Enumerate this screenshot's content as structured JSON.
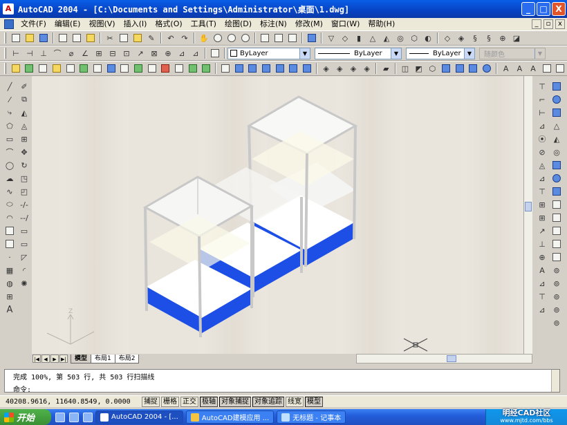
{
  "window": {
    "title": "AutoCAD 2004 - [C:\\Documents and Settings\\Administrator\\桌面\\1.dwg]",
    "app_icon": "A",
    "min_label": "_",
    "max_label": "□",
    "close_label": "X"
  },
  "menu": {
    "items": [
      {
        "label": "文件(F)"
      },
      {
        "label": "编辑(E)"
      },
      {
        "label": "视图(V)"
      },
      {
        "label": "插入(I)"
      },
      {
        "label": "格式(O)"
      },
      {
        "label": "工具(T)"
      },
      {
        "label": "绘图(D)"
      },
      {
        "label": "标注(N)"
      },
      {
        "label": "修改(M)"
      },
      {
        "label": "窗口(W)"
      },
      {
        "label": "帮助(H)"
      }
    ],
    "doc_min": "_",
    "doc_restore": "▫",
    "doc_close": "x"
  },
  "properties": {
    "layer_color": "ByLayer",
    "linetype": "ByLayer",
    "lineweight": "ByLayer",
    "plotstyle": "随颜色"
  },
  "layout_tabs": {
    "nav": [
      "|◀",
      "◀",
      "▶",
      "▶|"
    ],
    "tabs": [
      {
        "label": "模型",
        "active": true
      },
      {
        "label": "布局1",
        "active": false
      },
      {
        "label": "布局2",
        "active": false
      }
    ]
  },
  "ucs": {
    "z_label": "Z"
  },
  "command": {
    "line1": "完成 100%, 第 503 行, 共 503 行扫描线",
    "line2": "命令:"
  },
  "status": {
    "coords": "40208.9616, 11640.8549, 0.0000",
    "buttons": [
      {
        "label": "捕捉",
        "on": false
      },
      {
        "label": "栅格",
        "on": false
      },
      {
        "label": "正交",
        "on": false
      },
      {
        "label": "极轴",
        "on": true
      },
      {
        "label": "对象捕捉",
        "on": true
      },
      {
        "label": "对象追踪",
        "on": true
      },
      {
        "label": "线宽",
        "on": false
      },
      {
        "label": "模型",
        "on": true
      }
    ]
  },
  "taskbar": {
    "start_label": "开始",
    "tasks": [
      {
        "label": "AutoCAD 2004 - [...",
        "active": true
      },
      {
        "label": "AutoCAD建模应用 ...",
        "active": false
      },
      {
        "label": "无标题 - 记事本",
        "active": false
      }
    ],
    "tray_brand": "明经CAD社区",
    "tray_url": "www.mjtd.com/bbs"
  },
  "colors": {
    "base_blue": "#1d4fe6",
    "frame": "#c8c8c8",
    "glass_top": "#f4f4f2",
    "canvas": "#e9e4dc"
  }
}
